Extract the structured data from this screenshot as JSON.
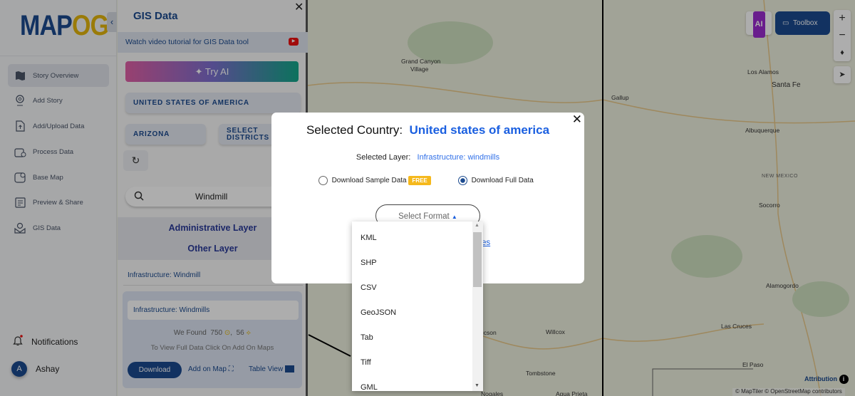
{
  "logo": {
    "part1": "MAP",
    "part2": "OG"
  },
  "sidebar": {
    "items": [
      {
        "label": "Story Overview",
        "icon": "map-icon"
      },
      {
        "label": "Add Story",
        "icon": "location-pin-icon"
      },
      {
        "label": "Add/Upload Data",
        "icon": "upload-file-icon"
      },
      {
        "label": "Process Data",
        "icon": "process-data-icon"
      },
      {
        "label": "Base Map",
        "icon": "base-map-icon"
      },
      {
        "label": "Preview & Share",
        "icon": "preview-icon"
      },
      {
        "label": "GIS Data",
        "icon": "gis-data-icon"
      }
    ],
    "notifications": "Notifications",
    "user_initial": "A",
    "user_name": "Ashay"
  },
  "panel": {
    "title": "GIS Data",
    "tutorial": "Watch video tutorial for GIS Data tool",
    "try_ai": "Try AI",
    "country": "UNITED STATES OF AMERICA",
    "state": "ARIZONA",
    "districts_line1": "SELECT",
    "districts_line2": "DISTRICTS",
    "search_value": "Windmill",
    "admin_layer": "Administrative Layer",
    "other_layer": "Other Layer",
    "category": "Infrastructure: Windmill",
    "card": {
      "layer": "Infrastructure: Windmills",
      "found_prefix": "We Found",
      "points": "750",
      "sep": ",",
      "polygons": "56",
      "hint": "To View Full Data Click On Add On Maps",
      "download": "Download",
      "add_on_map": "Add on Map",
      "table_view": "Table View"
    }
  },
  "map": {
    "labels": [
      {
        "t": "Grand Canyon"
      },
      {
        "t": "Village"
      },
      {
        "t": "Gallup"
      },
      {
        "t": "Los Alamos"
      },
      {
        "t": "Santa Fe"
      },
      {
        "t": "Albuquerque"
      },
      {
        "t": "NEW MEXICO"
      },
      {
        "t": "Socorro"
      },
      {
        "t": "Alamogordo"
      },
      {
        "t": "Las Cruces"
      },
      {
        "t": "El Paso"
      },
      {
        "t": "ucson"
      },
      {
        "t": "Willcox"
      },
      {
        "t": "Tombstone"
      },
      {
        "t": "Nogales"
      },
      {
        "t": "Agua Prieta"
      }
    ],
    "toolbox": "Toolbox",
    "ai_badge": "AI",
    "zoom_in": "+",
    "zoom_out": "−",
    "attribution": "Attribution",
    "credits": "© MapTiler © OpenStreetMap contributors"
  },
  "modal": {
    "country_label": "Selected Country:",
    "country_value": "United states of america",
    "layer_label": "Selected Layer:",
    "layer_value": "Infrastructure: windmills",
    "sample_label": "Download Sample Data",
    "free_badge": "FREE",
    "full_label": "Download Full Data",
    "selected_option": "full",
    "format_placeholder": "Select Format",
    "link_fragment": "es",
    "accent": "#1a5fe0"
  },
  "dropdown": {
    "options": [
      "KML",
      "SHP",
      "CSV",
      "GeoJSON",
      "Tab",
      "Tiff",
      "GML"
    ]
  }
}
